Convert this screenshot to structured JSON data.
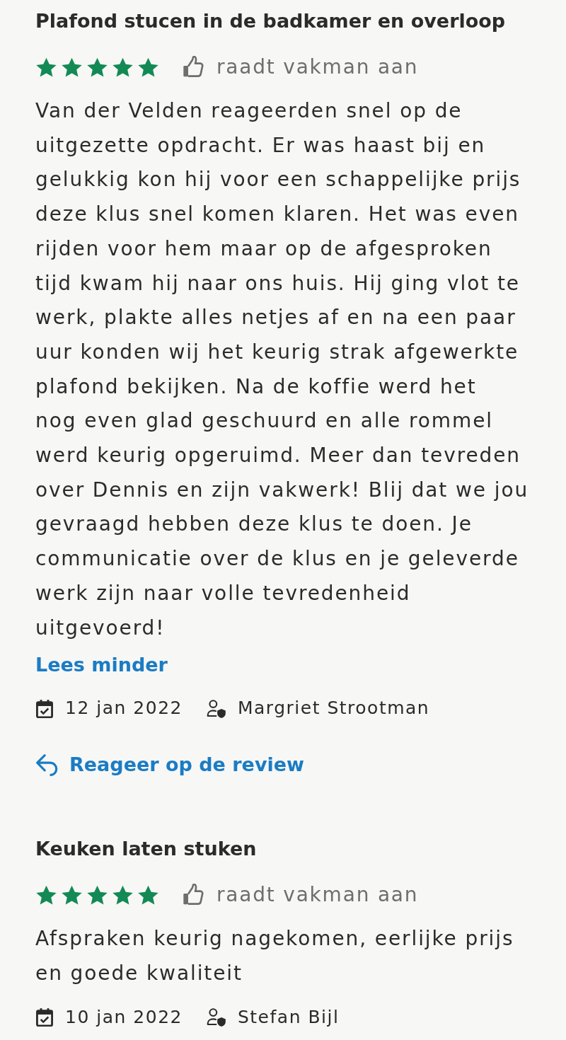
{
  "reviews": [
    {
      "title": "Plafond stucen in de badkamer en overloop",
      "stars": 5,
      "recommend_label": "raadt vakman aan",
      "body_lines": [
        "Van der Velden reageerden snel op de",
        "uitgezette opdracht. Er was haast bij en",
        "gelukkig kon hij voor een schappelijke prijs",
        "deze klus snel komen klaren. Het was even",
        "rijden voor hem maar op de afgesproken",
        "tijd kwam hij naar ons huis. Hij ging vlot te",
        "werk, plakte alles netjes af en na een paar",
        "uur konden wij het keurig strak afgewerkte",
        "plafond bekijken. Na de koffie werd het",
        "nog even glad geschuurd en alle rommel",
        "werd keurig opgeruimd. Meer dan tevreden",
        "over Dennis en zijn vakwerk! Blij dat we jou",
        "gevraagd hebben deze klus te doen. Je",
        "communicatie over de klus en je geleverde",
        "werk zijn naar volle tevredenheid",
        "uitgevoerd!"
      ],
      "toggle_link": "Lees minder",
      "date": "12 jan 2022",
      "author": "Margriet Strootman",
      "reply_link": "Reageer op de review"
    },
    {
      "title": "Keuken laten stuken",
      "stars": 5,
      "recommend_label": "raadt vakman aan",
      "body_lines": [
        "Afspraken keurig nagekomen, eerlijke prijs",
        "en goede kwaliteit"
      ],
      "date": "10 jan 2022",
      "author": "Stefan Bijl"
    }
  ]
}
